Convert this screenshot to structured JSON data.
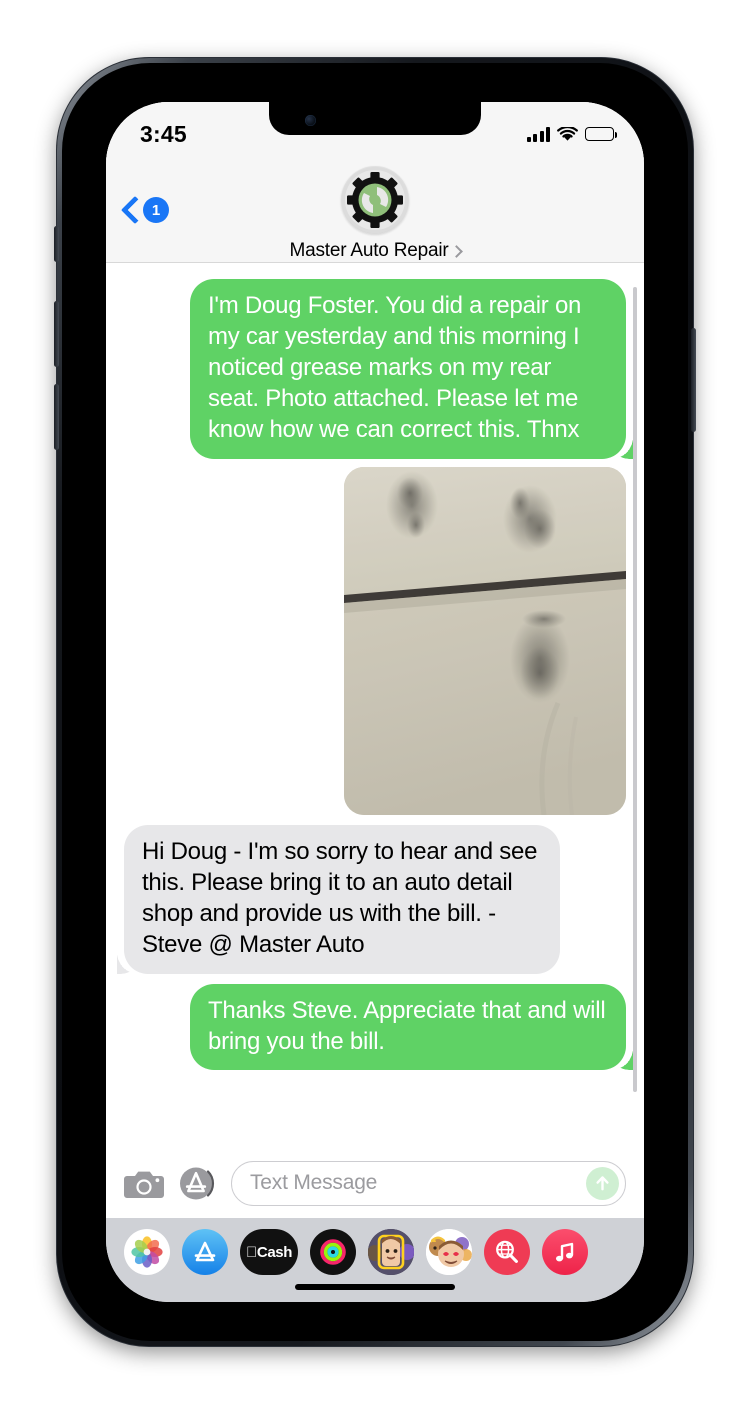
{
  "status_bar": {
    "time": "3:45",
    "signal_icon": "cellular-signal-icon",
    "wifi_icon": "wifi-icon",
    "battery_icon": "battery-icon"
  },
  "header": {
    "back_badge": "1",
    "back_icon": "chevron-left-icon",
    "contact_name": "Master Auto Repair",
    "disclosure_icon": "chevron-right-icon",
    "avatar_icon": "gear-wrench-logo",
    "avatar_colors": {
      "gear": "#111111",
      "inner_circle": "#8FBF7A",
      "ring": "#D5D5D5"
    }
  },
  "conversation": {
    "messages": [
      {
        "id": "msg-1",
        "direction": "outgoing",
        "type": "text",
        "text": "I'm Doug Foster. You did a repair on my car yesterday and this morning I noticed grease marks on my rear seat. Photo attached. Please let me know how we can correct this.  Thnx"
      },
      {
        "id": "msg-2",
        "direction": "outgoing",
        "type": "photo",
        "alt": "photo of car rear seat with grease marks"
      },
      {
        "id": "msg-3",
        "direction": "incoming",
        "type": "text",
        "text": "Hi Doug - I'm so sorry to hear and see this. Please bring it to an auto detail shop and provide us with the bill. - Steve @ Master Auto"
      },
      {
        "id": "msg-4",
        "direction": "outgoing",
        "type": "text",
        "text": "Thanks Steve. Appreciate that and will bring you the bill."
      }
    ],
    "bubble_colors": {
      "outgoing": "#5FD265",
      "incoming": "#E7E7E9"
    }
  },
  "input_bar": {
    "camera_icon": "camera-icon",
    "appstore_icon": "app-store-icon",
    "placeholder": "Text Message",
    "value": "",
    "send_icon": "send-arrow-up-icon"
  },
  "app_drawer": {
    "apps": [
      {
        "name": "photos-app-icon",
        "label": "Photos"
      },
      {
        "name": "app-store-app-icon",
        "label": "App Store"
      },
      {
        "name": "apple-cash-app-icon",
        "label": "Cash"
      },
      {
        "name": "fitness-rings-app-icon",
        "label": "Fitness"
      },
      {
        "name": "memoji-app-icon",
        "label": "Memoji"
      },
      {
        "name": "memoji-stickers-app-icon",
        "label": "Memoji Stickers"
      },
      {
        "name": "images-search-app-icon",
        "label": "#images"
      },
      {
        "name": "music-app-icon",
        "label": "Music"
      }
    ]
  }
}
